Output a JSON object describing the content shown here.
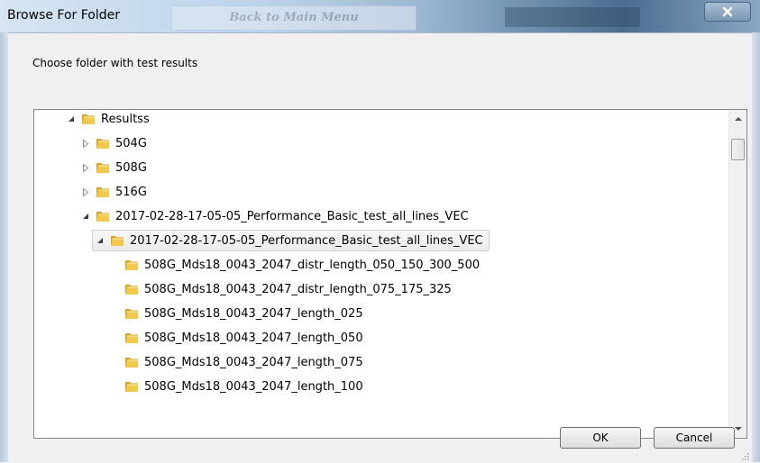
{
  "window": {
    "title": "Browse For Folder",
    "background_window_text": "Back to Main Menu"
  },
  "dialog": {
    "instruction": "Choose folder with test results",
    "ok_label": "OK",
    "cancel_label": "Cancel"
  },
  "tree": {
    "items": [
      {
        "label": "Resultss",
        "expander": "expanded"
      },
      {
        "label": "504G",
        "expander": "collapsed"
      },
      {
        "label": "508G",
        "expander": "collapsed"
      },
      {
        "label": "516G",
        "expander": "collapsed"
      },
      {
        "label": "2017-02-28-17-05-05_Performance_Basic_test_all_lines_VEC",
        "expander": "expanded"
      },
      {
        "label": "2017-02-28-17-05-05_Performance_Basic_test_all_lines_VEC",
        "expander": "expanded",
        "selected": true
      },
      {
        "label": "508G_Mds18_0043_2047_distr_length_050_150_300_500",
        "expander": "none"
      },
      {
        "label": "508G_Mds18_0043_2047_distr_length_075_175_325",
        "expander": "none"
      },
      {
        "label": "508G_Mds18_0043_2047_length_025",
        "expander": "none"
      },
      {
        "label": "508G_Mds18_0043_2047_length_050",
        "expander": "none"
      },
      {
        "label": "508G_Mds18_0043_2047_length_075",
        "expander": "none"
      },
      {
        "label": "508G_Mds18_0043_2047_length_100",
        "expander": "none"
      }
    ]
  },
  "icons": {
    "folder": "folder-icon",
    "expanded": "expanded-triangle-icon",
    "collapsed": "collapsed-triangle-icon",
    "close": "close-icon"
  },
  "colors": {
    "folder_front": "#f2c94c",
    "folder_back": "#d9a521",
    "selection_border": "#d0d0d0"
  }
}
